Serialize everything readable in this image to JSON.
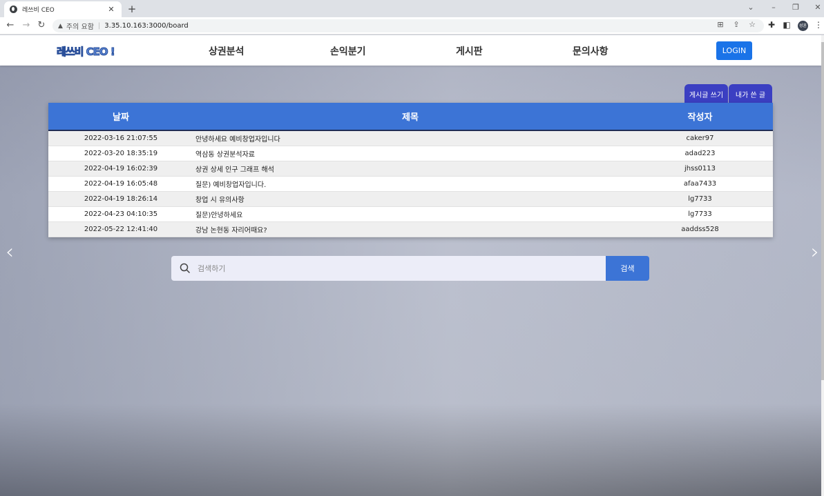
{
  "browser": {
    "tab_title": "레쓰비 CEO",
    "tab_close": "✕",
    "new_tab": "+",
    "warning_text": "주의 요함",
    "separator": "|",
    "url": "3.35.10.163:3000/board",
    "profile_label": "성훈"
  },
  "header": {
    "logo": "레쓰비 CEO !",
    "nav": [
      "상권분석",
      "손익분기",
      "게시판",
      "문의사항"
    ],
    "login_label": "LOGIN"
  },
  "actions": {
    "write_label": "게시글 쓰기",
    "my_posts_label": "내가 쓴 글"
  },
  "board": {
    "columns": [
      "날짜",
      "제목",
      "작성자"
    ],
    "rows": [
      {
        "date": "2022-03-16 21:07:55",
        "title": "안녕하세요 예비창업자입니다",
        "author": "caker97"
      },
      {
        "date": "2022-03-20 18:35:19",
        "title": "역삼동 상권분석자료",
        "author": "adad223"
      },
      {
        "date": "2022-04-19 16:02:39",
        "title": "상권 상세 인구 그래프 해석",
        "author": "jhss0113"
      },
      {
        "date": "2022-04-19 16:05:48",
        "title": "질문) 예비창업자입니다.",
        "author": "afaa7433"
      },
      {
        "date": "2022-04-19 18:26:14",
        "title": "창업 시 유의사항",
        "author": "lg7733"
      },
      {
        "date": "2022-04-23 04:10:35",
        "title": "질문)안녕하세요",
        "author": "lg7733"
      },
      {
        "date": "2022-05-22 12:41:40",
        "title": "강남 논현동 자리어때요?",
        "author": "aaddss528"
      }
    ]
  },
  "search": {
    "placeholder": "검색하기",
    "button_label": "검색"
  },
  "carousel": {
    "prev": "‹",
    "next": "›"
  }
}
